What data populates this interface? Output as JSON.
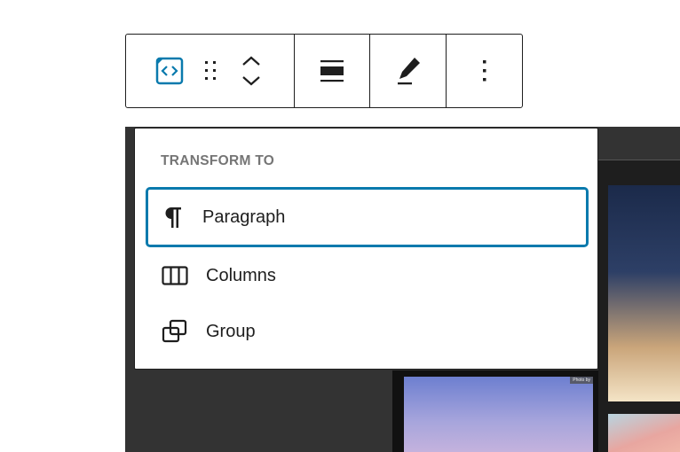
{
  "toolbar": {
    "buttons": [
      "Block type: Custom HTML",
      "Drag",
      "Move up",
      "Move down",
      "Align",
      "Highlight",
      "Options"
    ]
  },
  "menu": {
    "title": "TRANSFORM TO",
    "items": [
      {
        "label": "Paragraph",
        "selected": true
      },
      {
        "label": "Columns"
      },
      {
        "label": "Group"
      }
    ]
  },
  "background": {
    "photo_credit": "Photo by"
  },
  "colors": {
    "accent": "#0a7aad",
    "text": "#1e1e1e",
    "muted": "#757575"
  }
}
